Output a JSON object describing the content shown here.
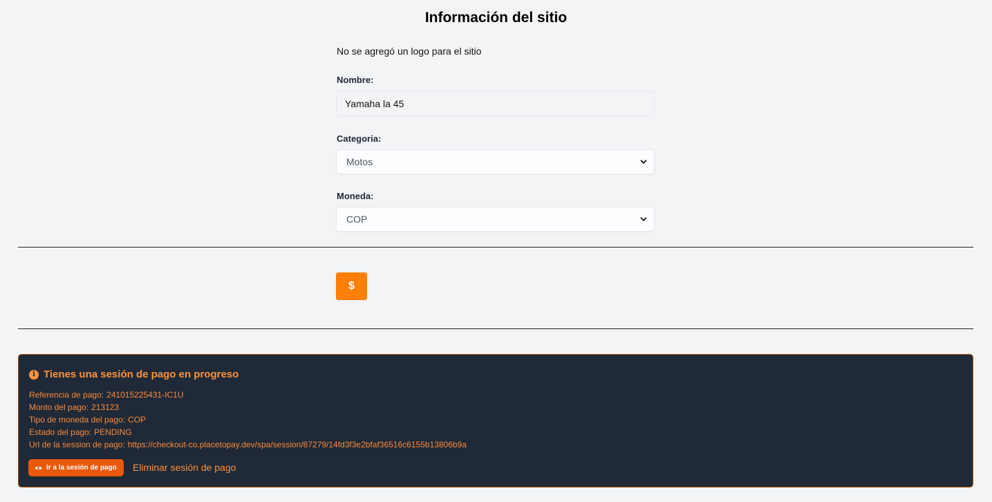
{
  "page": {
    "title": "Información del sitio",
    "no_logo_text": "No se agregó un logo para el sitio"
  },
  "form": {
    "name_label": "Nombre:",
    "name_value": "Yamaha la 45",
    "category_label": "Categoria:",
    "category_value": "Motos",
    "currency_label": "Moneda:",
    "currency_value": "COP"
  },
  "pay_button": {
    "label": "$",
    "color": "#ff7f0a"
  },
  "session_alert": {
    "title": "Tienes una sesión de pago en progreso",
    "icon": "info-icon",
    "rows": [
      {
        "label": "Referencia de pago:",
        "value": "241015225431-IC1U"
      },
      {
        "label": "Monto del pago:",
        "value": "213123"
      },
      {
        "label": "Tipo de moneda del pago:",
        "value": "COP"
      },
      {
        "label": "Estado del pago:",
        "value": "PENDING"
      },
      {
        "label": "Url de la session de pago:",
        "value": "https://checkout-co.placetopay.dev/spa/session/87279/14fd3f3e2bfaf36516c6155b13806b9a"
      }
    ],
    "go_button_label": "Ir a la sesión de pago",
    "go_button_icon": "eye-icon",
    "delete_link_label": "Eliminar sesión de pago",
    "background_color": "#1f2937",
    "accent_color": "#f97316"
  }
}
